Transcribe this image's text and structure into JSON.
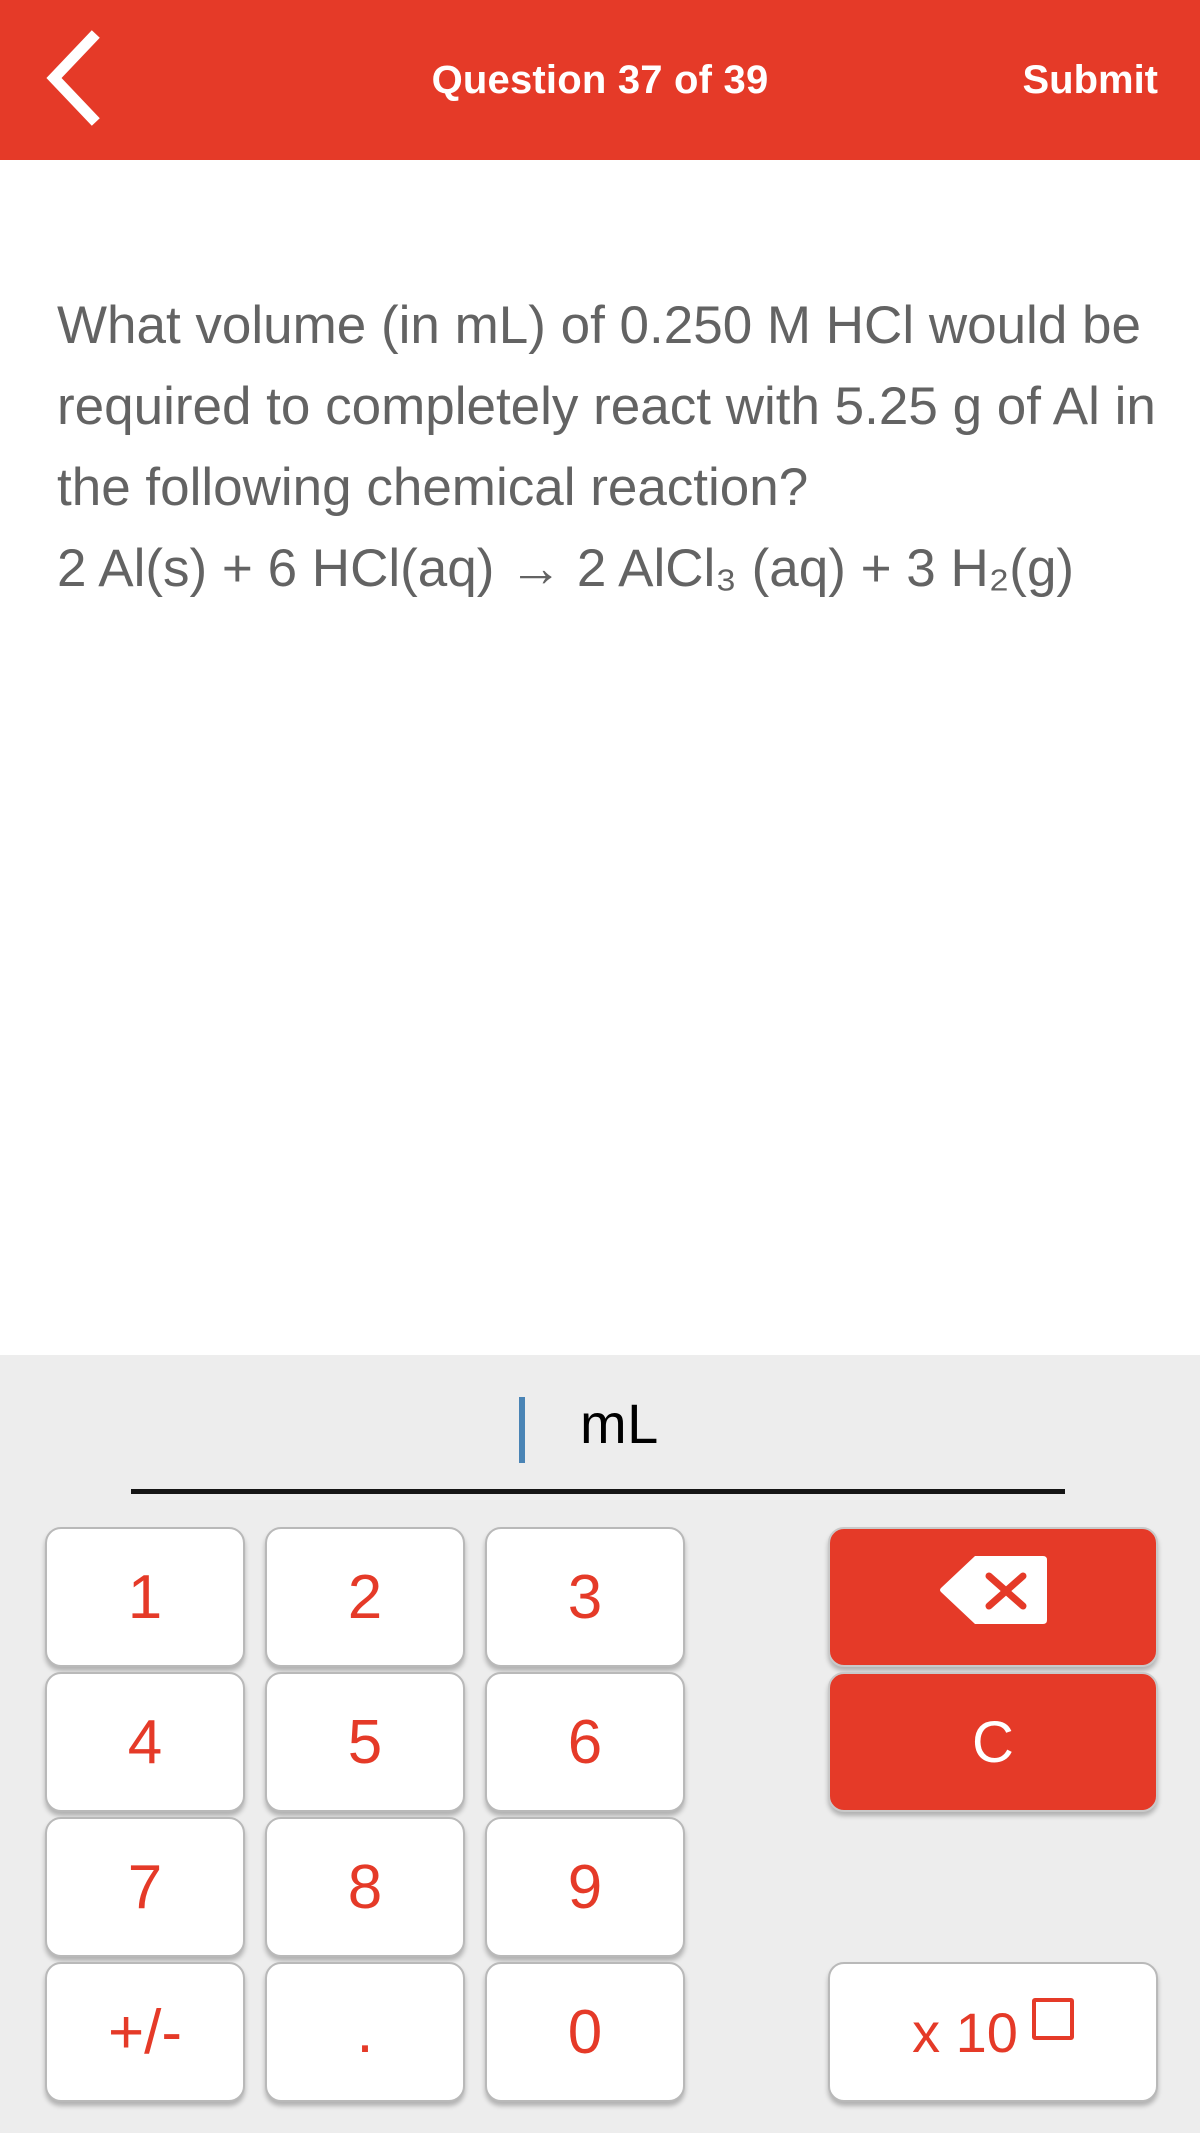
{
  "header": {
    "back_icon": "chevron-left-icon",
    "title": "Question 37 of 39",
    "submit_label": "Submit",
    "background_color": "#E53A28",
    "text_color": "#FFFFFF"
  },
  "question": {
    "text": "What volume (in mL) of 0.250 M HCl would be required to completely react with 5.25 g of Al in the following chemical reaction?\n2 Al(s) + 6 HCl(aq) → 2 AlCl₃ (aq) + 3 H₂(g)",
    "text_color": "#636363"
  },
  "answer": {
    "value": "",
    "unit": "mL",
    "caret_color": "#4A84B5",
    "underline_color": "#151515"
  },
  "keypad": {
    "background_color": "#EDEDED",
    "digit_color": "#E53A28",
    "keys": [
      {
        "label": "1",
        "name": "key-1"
      },
      {
        "label": "2",
        "name": "key-2"
      },
      {
        "label": "3",
        "name": "key-3"
      },
      {
        "label": "4",
        "name": "key-4"
      },
      {
        "label": "5",
        "name": "key-5"
      },
      {
        "label": "6",
        "name": "key-6"
      },
      {
        "label": "7",
        "name": "key-7"
      },
      {
        "label": "8",
        "name": "key-8"
      },
      {
        "label": "9",
        "name": "key-9"
      },
      {
        "label": "+/-",
        "name": "key-sign"
      },
      {
        "label": ".",
        "name": "key-decimal"
      },
      {
        "label": "0",
        "name": "key-0"
      }
    ],
    "backspace": {
      "icon": "backspace-icon",
      "label": ""
    },
    "clear": {
      "label": "C",
      "name": "key-clear"
    },
    "exponent": {
      "label": "x 10",
      "name": "key-exponent"
    }
  }
}
